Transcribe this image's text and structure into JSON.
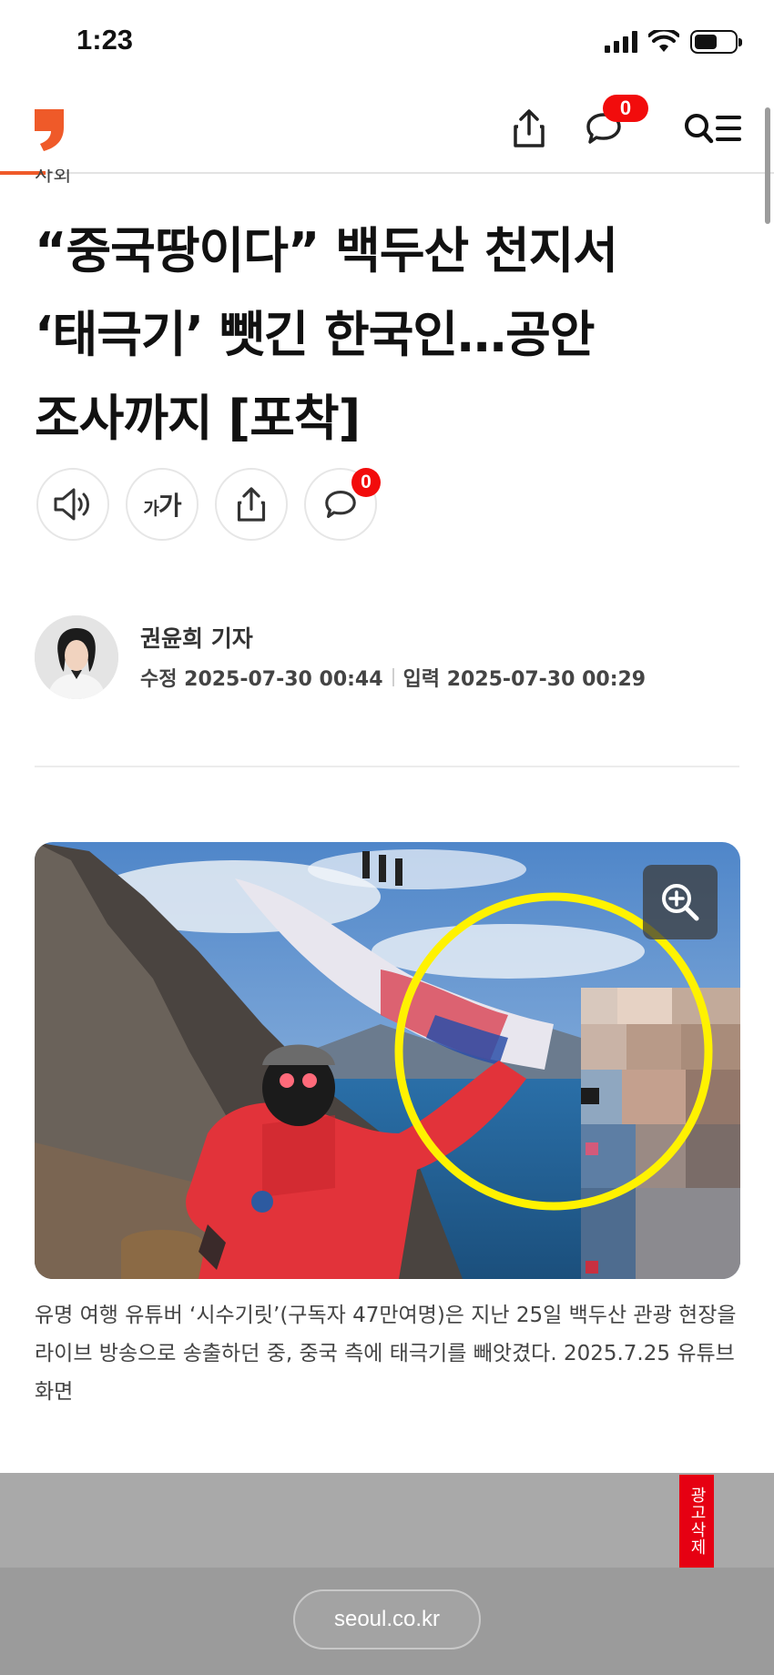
{
  "status_bar": {
    "time": "1:23"
  },
  "header": {
    "comment_count": "0",
    "logo_color": "#EF5A29"
  },
  "article": {
    "section_label_partial": "사회",
    "title_lines": [
      "“중국땅이다” 백두산 천지서",
      "‘태극기’ 뺏긴 한국인…공안",
      "조사까지 [포착]"
    ],
    "font_button_small": "가",
    "font_button_large": "가",
    "comment_count": "0",
    "author": {
      "name": "권윤희 기자",
      "modified": "수정 2025-07-30 00:44",
      "published": "입력 2025-07-30 00:29"
    },
    "photo_caption": "유명 여행 유튜버 ‘시수기릿’(구독자 47만여명)은 지난 25일 백두산 관광 현장을 라이브 방송으로 송출하던 중, 중국 측에 태극기를 빼앗겼다. 2025.7.25 유튜브 화면"
  },
  "ad": {
    "remove_label": "광고삭제"
  },
  "browser": {
    "url": "seoul.co.kr"
  },
  "icons": [
    "signal-icon",
    "wifi-icon",
    "battery-icon",
    "share-icon",
    "comment-icon",
    "search-menu-icon",
    "speaker-icon",
    "font-size-icon",
    "zoom-in-icon"
  ],
  "colors": {
    "accent": "#EF5A29",
    "badge": "#F20C0C",
    "highlight_circle": "#FFF200"
  }
}
